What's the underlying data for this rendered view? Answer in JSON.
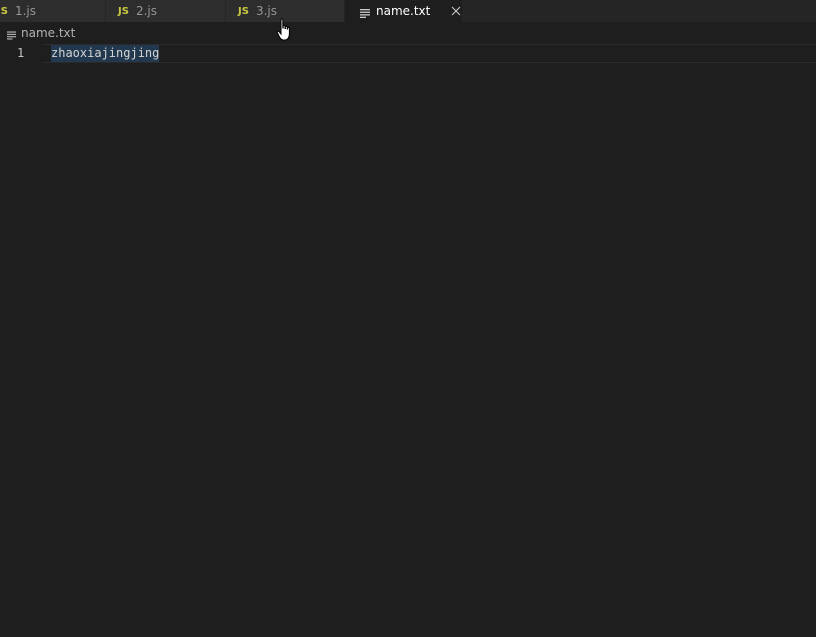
{
  "tabs": [
    {
      "icon": "js-file-icon",
      "icon_text": "JS",
      "label": "1.js",
      "active": false
    },
    {
      "icon": "js-file-icon",
      "icon_text": "JS",
      "label": "2.js",
      "active": false
    },
    {
      "icon": "js-file-icon",
      "icon_text": "JS",
      "label": "3.js",
      "active": false
    },
    {
      "icon": "text-file-icon",
      "label": "name.txt",
      "active": true,
      "close_icon": "close-icon"
    }
  ],
  "breadcrumb": {
    "icon": "text-file-icon",
    "label": "name.txt"
  },
  "editor": {
    "lines": [
      {
        "number": "1",
        "text": "zhaoxiajingjing",
        "selected": true
      }
    ]
  },
  "colors": {
    "background": "#1e1e1e",
    "tab_inactive": "#2d2d2d",
    "js_icon": "#cbcb41",
    "selection": "#264f78"
  },
  "mouse_cursor": "hand-pointer-icon"
}
